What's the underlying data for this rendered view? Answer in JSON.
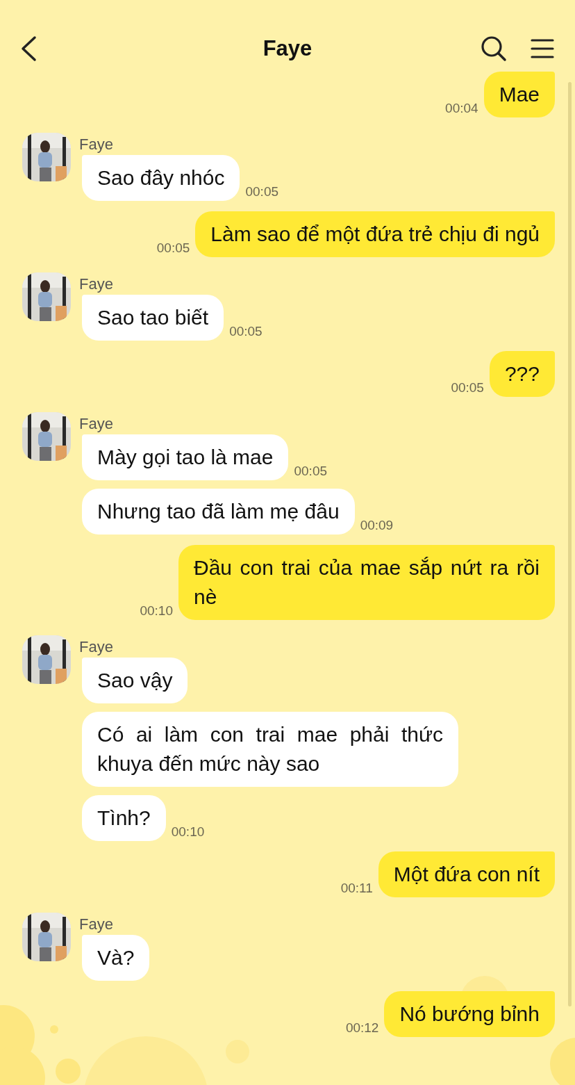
{
  "header": {
    "title": "Faye"
  },
  "messages": [
    {
      "kind": "sent",
      "text": "Mae",
      "time": "00:04"
    },
    {
      "kind": "received",
      "sender": "Faye",
      "bubbles": [
        {
          "text": "Sao đây nhóc",
          "time": "00:05"
        }
      ]
    },
    {
      "kind": "sent",
      "text": "Làm sao để một đứa trẻ chịu đi ngủ",
      "time": "00:05"
    },
    {
      "kind": "received",
      "sender": "Faye",
      "bubbles": [
        {
          "text": "Sao tao biết",
          "time": "00:05"
        }
      ]
    },
    {
      "kind": "sent",
      "text": "???",
      "time": "00:05"
    },
    {
      "kind": "received",
      "sender": "Faye",
      "bubbles": [
        {
          "text": "Mày gọi tao là mae",
          "time": "00:05"
        },
        {
          "text": "Nhưng tao đã làm mẹ đâu",
          "time": "00:09"
        }
      ]
    },
    {
      "kind": "sent",
      "text": "Đầu con trai của mae sắp nứt ra rồi nè",
      "time": "00:10"
    },
    {
      "kind": "received",
      "sender": "Faye",
      "bubbles": [
        {
          "text": "Sao vậy"
        },
        {
          "text": "Có ai làm con trai mae phải thức khuya đến mức này sao"
        },
        {
          "text": "Tình?",
          "time": "00:10"
        }
      ]
    },
    {
      "kind": "sent",
      "text": "Một đứa con nít",
      "time": "00:11"
    },
    {
      "kind": "received",
      "sender": "Faye",
      "bubbles": [
        {
          "text": "Và?"
        }
      ]
    },
    {
      "kind": "sent",
      "text": "Nó bướng bỉnh",
      "time": "00:12"
    }
  ]
}
